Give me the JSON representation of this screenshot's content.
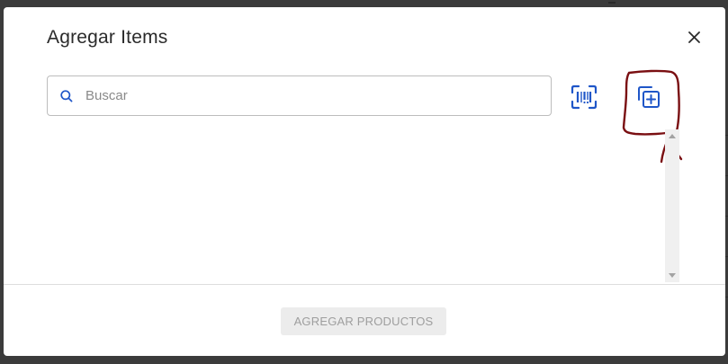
{
  "modal": {
    "title": "Agregar Items",
    "close_icon": "close-icon",
    "search": {
      "placeholder": "Buscar",
      "value": "",
      "icon": "search-icon"
    },
    "actions": {
      "barcode_icon": "barcode-scan-icon",
      "add_item_icon": "copy-plus-icon"
    },
    "footer": {
      "submit_label": "AGREGAR PRODUCTOS",
      "submit_disabled": true
    }
  },
  "colors": {
    "accent": "#1f56c8",
    "overlay": "#3b3b3b",
    "annotation": "#7a0f12",
    "disabled_bg": "#ececec",
    "disabled_text": "#9e9e9e"
  }
}
